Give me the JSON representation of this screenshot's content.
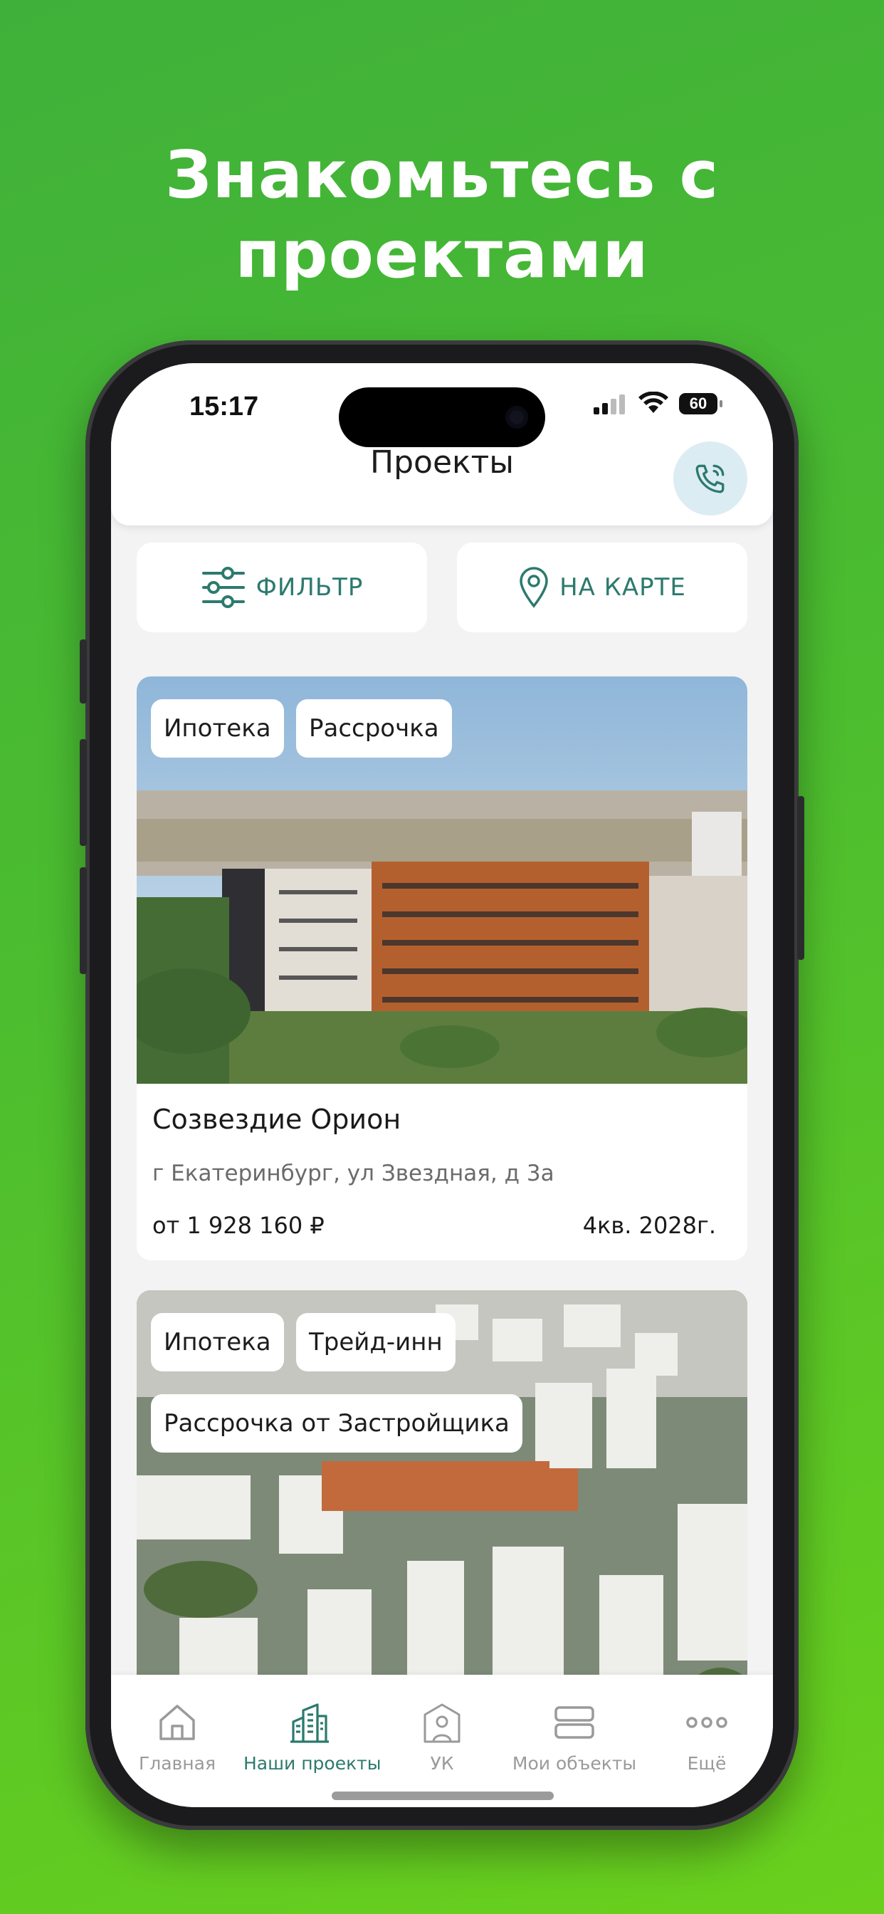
{
  "promo": {
    "line1": "Знакомьтесь с",
    "line2": "проектами"
  },
  "status_bar": {
    "time": "15:17",
    "battery": "60"
  },
  "header": {
    "title": "Проекты",
    "call_icon": "phone-call-icon"
  },
  "actions": {
    "filter_label": "ФИЛЬТР",
    "map_label": "НА КАРТЕ"
  },
  "projects": [
    {
      "tags": [
        "Ипотека",
        "Рассрочка"
      ],
      "title": "Созвездие Орион",
      "address": "г Екатеринбург, ул Звездная, д 3а",
      "price": "от 1 928 160 ₽",
      "deadline": "4кв. 2028г."
    },
    {
      "tags": [
        "Ипотека",
        "Трейд-инн",
        "Рассрочка от Застройщика"
      ]
    }
  ],
  "tabs": [
    {
      "label": "Главная",
      "icon": "home-icon"
    },
    {
      "label": "Наши проекты",
      "icon": "buildings-icon"
    },
    {
      "label": "УК",
      "icon": "manager-building-icon"
    },
    {
      "label": "Мои объекты",
      "icon": "stack-icon"
    },
    {
      "label": "Ещё",
      "icon": "more-icon"
    }
  ],
  "colors": {
    "accent": "#2c7a6e",
    "background": "#4cbd2f"
  }
}
